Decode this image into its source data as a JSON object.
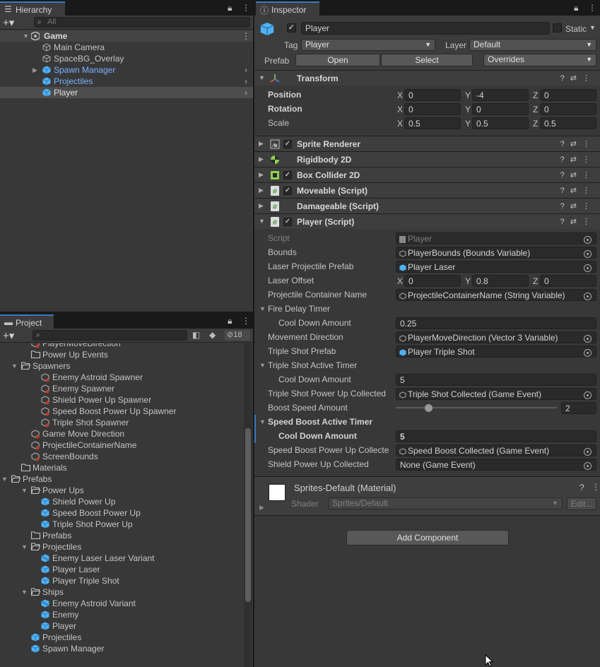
{
  "hierarchy": {
    "tab": "Hierarchy",
    "search_placeholder": "All",
    "items": [
      {
        "label": "Game"
      },
      {
        "label": "Main Camera"
      },
      {
        "label": "SpaceBG_Overlay"
      },
      {
        "label": "Spawn Manager"
      },
      {
        "label": "Projectiles"
      },
      {
        "label": "Player"
      }
    ]
  },
  "project": {
    "tab": "Project",
    "hidden_count": "18",
    "items": [
      {
        "label": "PlayerMoveDirection"
      },
      {
        "label": "Power Up Events"
      },
      {
        "label": "Spawners"
      },
      {
        "label": "Enemy Astroid Spawner"
      },
      {
        "label": "Enemy Spawner"
      },
      {
        "label": "Shield Power Up Spawner"
      },
      {
        "label": "Speed Boost Power Up Spawner"
      },
      {
        "label": "Triple Shot Spawner"
      },
      {
        "label": "Game Move Direction"
      },
      {
        "label": "ProjectileContainerName"
      },
      {
        "label": "ScreenBounds"
      },
      {
        "label": "Materials"
      },
      {
        "label": "Prefabs"
      },
      {
        "label": "Power Ups"
      },
      {
        "label": "Shield Power Up"
      },
      {
        "label": "Speed Boost Power Up"
      },
      {
        "label": "Triple Shot Power Up"
      },
      {
        "label": "Prefabs"
      },
      {
        "label": "Projectiles"
      },
      {
        "label": "Enemy Laser Laser Variant"
      },
      {
        "label": "Player Laser"
      },
      {
        "label": "Player Triple Shot"
      },
      {
        "label": "Ships"
      },
      {
        "label": "Enemy Astroid Variant"
      },
      {
        "label": "Enemy"
      },
      {
        "label": "Player"
      },
      {
        "label": "Projectiles"
      },
      {
        "label": "Spawn Manager"
      }
    ]
  },
  "inspector": {
    "tab": "Inspector",
    "object_name": "Player",
    "static_label": "Static",
    "tag_label": "Tag",
    "tag_value": "Player",
    "layer_label": "Layer",
    "layer_value": "Default",
    "prefab_label": "Prefab",
    "open_label": "Open",
    "select_label": "Select",
    "overrides_label": "Overrides",
    "transform": {
      "title": "Transform",
      "position_label": "Position",
      "rotation_label": "Rotation",
      "scale_label": "Scale",
      "position": {
        "x": "0",
        "y": "-4",
        "z": "0"
      },
      "rotation": {
        "x": "0",
        "y": "0",
        "z": "0"
      },
      "scale": {
        "x": "0.5",
        "y": "0.5",
        "z": "0.5"
      }
    },
    "components": [
      {
        "name": "Sprite Renderer"
      },
      {
        "name": "Rigidbody 2D"
      },
      {
        "name": "Box Collider 2D"
      },
      {
        "name": "Moveable (Script)"
      },
      {
        "name": "Damageable (Script)"
      },
      {
        "name": "Player (Script)"
      }
    ],
    "player_script": {
      "script_label": "Script",
      "script_value": "Player",
      "bounds_label": "Bounds",
      "bounds_value": "PlayerBounds (Bounds Variable)",
      "laser_prefab_label": "Laser Projectile Prefab",
      "laser_prefab_value": "Player Laser",
      "laser_offset_label": "Laser Offset",
      "laser_offset": {
        "x": "0",
        "y": "0.8",
        "z": "0"
      },
      "container_label": "Projectile Container Name",
      "container_value": "ProjectileContainerName (String Variable)",
      "fire_delay_label": "Fire Delay Timer",
      "cooldown_label": "Cool Down Amount",
      "fire_cooldown_value": "0.25",
      "move_dir_label": "Movement Direction",
      "move_dir_value": "PlayerMoveDirection (Vector 3 Variable)",
      "triple_prefab_label": "Triple Shot Prefab",
      "triple_prefab_value": "Player Triple Shot",
      "triple_timer_label": "Triple Shot Active Timer",
      "triple_cooldown_value": "5",
      "triple_collected_label": "Triple Shot Power Up Collected",
      "triple_collected_value": "Triple Shot Collected (Game Event)",
      "boost_speed_label": "Boost Speed Amount",
      "boost_speed_value": "2",
      "boost_speed_slider": {
        "min": 0,
        "max": 10,
        "value": 2
      },
      "speed_timer_label": "Speed Boost Active Timer",
      "speed_cooldown_value": "5",
      "speed_collected_label": "Speed Boost Power Up Collecte",
      "speed_collected_value": "Speed Boost Collected (Game Event)",
      "shield_collected_label": "Shield Power Up Collected",
      "shield_collected_value": "None (Game Event)"
    },
    "material": {
      "name": "Sprites-Default (Material)",
      "shader_label": "Shader",
      "shader_value": "Sprites/Default",
      "edit_label": "Edit..."
    },
    "add_component_label": "Add Component"
  },
  "colors": {
    "selection_blue": "#3a79bb",
    "prefab_blue": "#7cb3ff",
    "cube_blue": "#4fb2f5"
  }
}
